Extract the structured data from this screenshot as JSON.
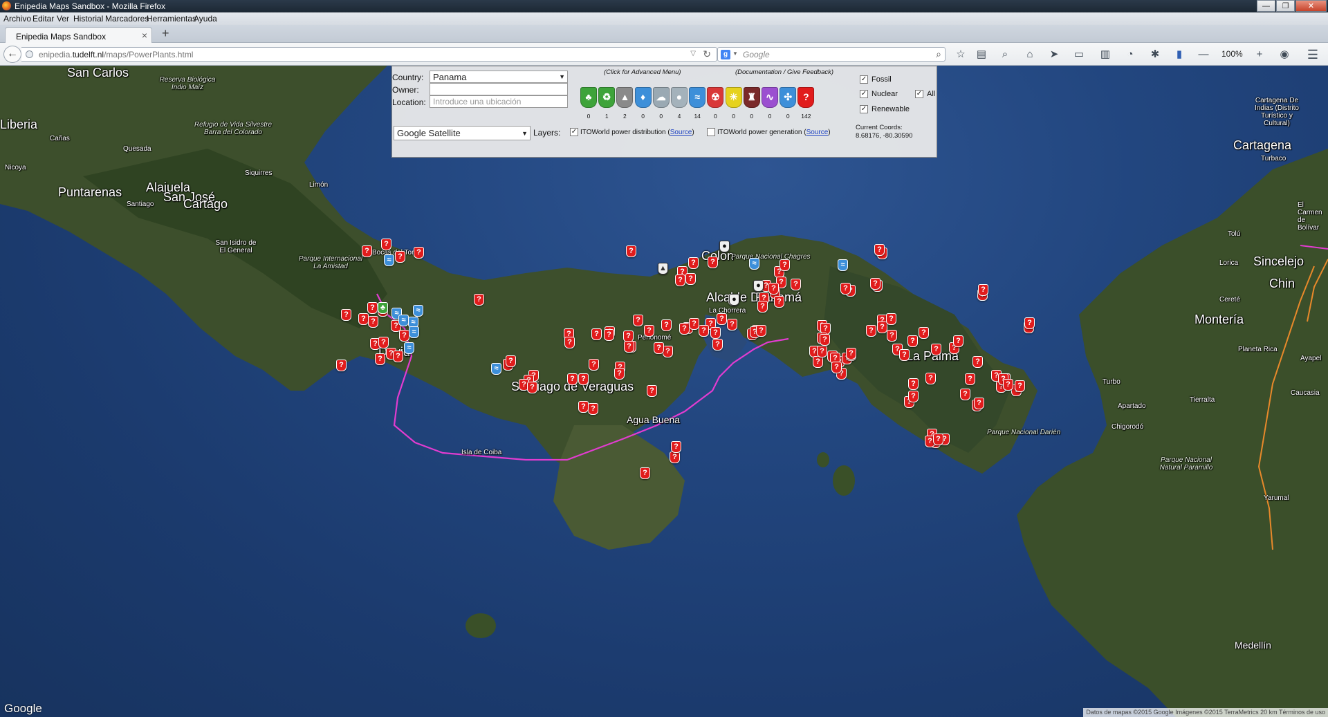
{
  "window": {
    "title": "Enipedia Maps Sandbox - Mozilla Firefox",
    "buttons": [
      "—",
      "❐",
      "✕"
    ]
  },
  "menubar": {
    "items": [
      "Archivo",
      "Editar",
      "Ver",
      "Historial",
      "Marcadores",
      "Herramientas",
      "Ayuda"
    ]
  },
  "tabs": [
    {
      "label": "Enipedia Maps Sandbox",
      "close": "×"
    }
  ],
  "newtab": "+",
  "nav": {
    "back": "←",
    "url_prefix": "enipedia.",
    "url_domain": "tudelft.nl",
    "url_path": "/maps/PowerPlants.html",
    "url_dropmarker": "▽",
    "reload": "↻",
    "search_engine": "g",
    "search_dropmarker": "▼",
    "search_placeholder": "Google",
    "search_go": "⌕",
    "zoom": "100%",
    "toolbar_icons": [
      "☆",
      "▤",
      "⌕",
      "⌂",
      "➤",
      "▭",
      "▥",
      "◔",
      "✱",
      "▮",
      "—",
      "+",
      "◉",
      "☰"
    ]
  },
  "panel": {
    "country_label": "Country:",
    "country_value": "Panama",
    "owner_label": "Owner:",
    "location_label": "Location:",
    "location_placeholder": "Introduce una ubicación",
    "advanced_menu": "(Click for Advanced Menu)",
    "documentation": "(Documentation / Give Feedback)",
    "maptype": "Google Satellite",
    "layers_label": "Layers:",
    "layer1": "ITOWorld power distribution",
    "layer1_checked": true,
    "layer2": "ITOWorld power generation",
    "layer2_checked": false,
    "source_link": "Source",
    "fossil": "Fossil",
    "nuclear": "Nuclear",
    "renewable": "Renewable",
    "all": "All",
    "check_mark": "✓",
    "coords_label": "Current Coords:",
    "coords_value": "8.68176, -80.30590",
    "fuels": [
      {
        "name": "biomass",
        "icon": "♣",
        "color": "#3ea33a",
        "count": "0"
      },
      {
        "name": "biogas",
        "icon": "♻",
        "color": "#3ea33a",
        "count": "1"
      },
      {
        "name": "coal",
        "icon": "▲",
        "color": "#8a8a8a",
        "count": "2"
      },
      {
        "name": "gas",
        "icon": "♦",
        "color": "#3d8fd9",
        "count": "0"
      },
      {
        "name": "geothermal",
        "icon": "☁",
        "color": "#9aa9b3",
        "count": "0"
      },
      {
        "name": "oil",
        "icon": "●",
        "color": "#a4b2bb",
        "count": "4"
      },
      {
        "name": "hydro",
        "icon": "≈",
        "color": "#3d8fd9",
        "count": "14"
      },
      {
        "name": "nuclear",
        "icon": "☢",
        "color": "#d93838",
        "count": "0"
      },
      {
        "name": "solar",
        "icon": "☀",
        "color": "#e6d21e",
        "count": "0"
      },
      {
        "name": "waste",
        "icon": "♜",
        "color": "#7a2a2a",
        "count": "0"
      },
      {
        "name": "wave",
        "icon": "∿",
        "color": "#9b4fd0",
        "count": "0"
      },
      {
        "name": "wind",
        "icon": "✣",
        "color": "#3d8fd9",
        "count": "0"
      },
      {
        "name": "unknown",
        "icon": "?",
        "color": "#e11c1c",
        "count": "142"
      }
    ]
  },
  "map": {
    "places": [
      "San Carlos",
      "Liberia",
      "Puntarenas",
      "Alajuela",
      "San José",
      "Cartago",
      "Limón",
      "Colón",
      "Alcalde Díaz",
      "Panamá",
      "La Chorrera",
      "Penonomé",
      "Santiago de Veraguas",
      "David",
      "Agua Buena",
      "Isla de Coiba",
      "La Palma",
      "Cartagena",
      "Turbaco",
      "Sincelejo",
      "Chin",
      "Montería",
      "Planeta Rica",
      "Turbo",
      "Apartado",
      "Chigorodó",
      "Tierralta",
      "Caucasia",
      "Medellín",
      "Bocas del Toro",
      "Cañas",
      "Quesada",
      "Nicoya",
      "Santiago",
      "Siquirres",
      "San Isidro de El General",
      "Tolú",
      "Lorica",
      "Cereté",
      "Yarumal",
      "Ayapel",
      "El Carmen de Bolívar"
    ],
    "parks": [
      "Reserva Biológica Indio Maíz",
      "Refugio de Vida Silvestre Barra del Colorado",
      "Parque Internacional La Amistad",
      "Parque Nacional Chagres",
      "Parque Nacional Darién",
      "Parque Nacional Natural Paramillo",
      "Cartagena De Indias (Distrito Turístico y Cultural)"
    ],
    "google_logo": "Google",
    "attribution": "Datos de mapas ©2015 Google Imágenes ©2015 TerraMetrics   20 km   Términos de uso",
    "marker_glyph": "?",
    "hydro_glyph": "≈",
    "oil_glyph": "●",
    "coal_glyph": "▲",
    "wood_glyph": "♣"
  }
}
